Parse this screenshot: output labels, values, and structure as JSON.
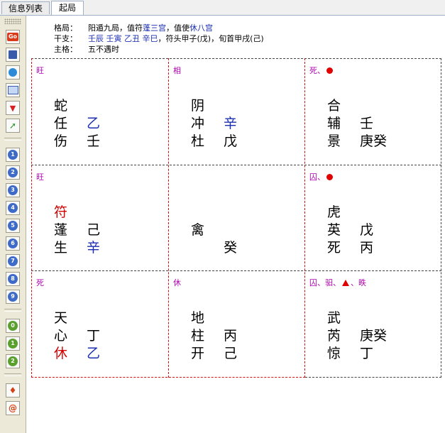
{
  "tabs": [
    "信息列表",
    "起局"
  ],
  "toolbar": {
    "go_label": "Go",
    "num1": [
      "1",
      "2",
      "3",
      "4",
      "5",
      "6",
      "7",
      "8",
      "9"
    ],
    "num2": [
      "0",
      "1",
      "2"
    ]
  },
  "info": {
    "geju_label": "格局：",
    "geju_value": "阳遁九局，值符",
    "geju_fu": "蓬三宫",
    "geju_mid": "，值使",
    "geju_shi": "休八宫",
    "ganzhi_label": "干支：",
    "ganzhi_value": "壬辰 壬寅 乙丑 辛巳",
    "ganzhi_rest": "，符头甲子(戊)，旬首甲戌(己)",
    "zhuge_label": "主格：",
    "zhuge_value": "五不遇时"
  },
  "cells": [
    {
      "state": "旺",
      "marks": [],
      "god": "蛇",
      "star": "任",
      "star_stem": "乙",
      "gate": "伤",
      "gate_stem": "壬"
    },
    {
      "state": "相",
      "marks": [],
      "god": "阴",
      "star": "冲",
      "star_stem": "辛",
      "gate": "杜",
      "gate_stem": "戊"
    },
    {
      "state": "死、",
      "marks": [
        "dot"
      ],
      "god": "合",
      "star": "辅",
      "star_stem": "壬",
      "gate": "景",
      "gate_stem": "庚癸"
    },
    {
      "state": "旺",
      "marks": [],
      "god": "符",
      "star": "蓬",
      "star_stem": "己",
      "gate": "生",
      "gate_stem": "辛"
    },
    {
      "state": "",
      "marks": [],
      "god": "",
      "star": "禽",
      "star_stem": "",
      "gate": "",
      "gate_stem": "癸"
    },
    {
      "state": "囚、",
      "marks": [
        "dot"
      ],
      "god": "虎",
      "star": "英",
      "star_stem": "戊",
      "gate": "死",
      "gate_stem": "丙"
    },
    {
      "state": "死",
      "marks": [],
      "god": "天",
      "star": "心",
      "star_stem": "丁",
      "gate": "休",
      "gate_stem": "乙"
    },
    {
      "state": "休",
      "marks": [],
      "god": "地",
      "star": "柱",
      "star_stem": "丙",
      "gate": "开",
      "gate_stem": "己"
    },
    {
      "state": "囚、驲、",
      "state_tail": "、昳",
      "marks": [
        "tri"
      ],
      "god": "武",
      "star": "芮",
      "star_stem": "庚癸",
      "gate": "惊",
      "gate_stem": "丁"
    }
  ]
}
